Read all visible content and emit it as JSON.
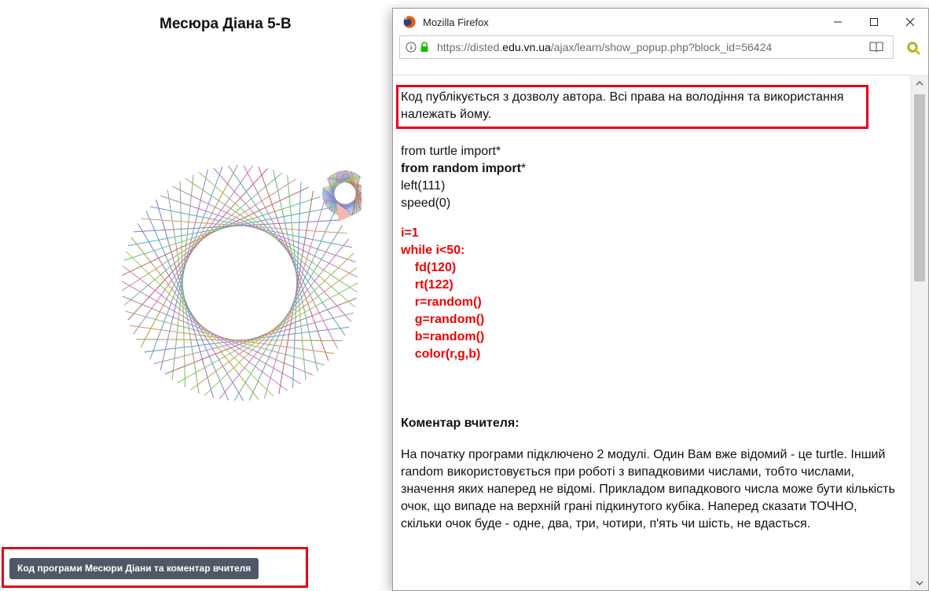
{
  "page": {
    "title": "Месюра Діана 5-В",
    "code_button_label": "Код програми Месюри Діани та коментар вчителя"
  },
  "popup": {
    "window_title": "Mozilla Firefox",
    "url_prefix": "https://disted.",
    "url_domain": "edu.vn.ua",
    "url_path": "/ajax/learn/show_popup.php?block_id=56424",
    "notice": "Код публікується з дозволу автора. Всі права на володіння та використання належать йому.",
    "code_plain": [
      "from turtle import*"
    ],
    "code_bold": "from random import",
    "code_bold_suffix": "*",
    "code_plain2": [
      "left(111)",
      "speed(0)"
    ],
    "code_red": [
      "i=1",
      "while i<50:",
      "    fd(120)",
      "    rt(122)",
      "    r=random()",
      "    g=random()",
      "    b=random()",
      "    color(r,g,b)"
    ],
    "comment_heading": "Коментар вчителя:",
    "comment_text": "На початку програми підключено 2 модулі. Один Вам вже відомий - це turtle. Інший random використовується при роботі з випадковими числами, тобто числами, значення яких наперед не відомі. Прикладом випадкового числа може бути кількість очок, що випаде на верхній грані підкинутого кубіка. Наперед сказати ТОЧНО, скільки очок буде  - одне, два, три, чотири, п'ять чи шість, не вдасться."
  },
  "icons": {
    "browser": "firefox-icon",
    "info": "info-icon",
    "lock": "lock-icon",
    "reader": "reader-view-icon",
    "extension": "extension-icon",
    "minimize": "minimize-icon",
    "maximize": "maximize-icon",
    "close": "close-icon"
  },
  "colors": {
    "highlight": "#e3001b",
    "code_red": "#ee0000",
    "button_bg": "#4f5866"
  }
}
